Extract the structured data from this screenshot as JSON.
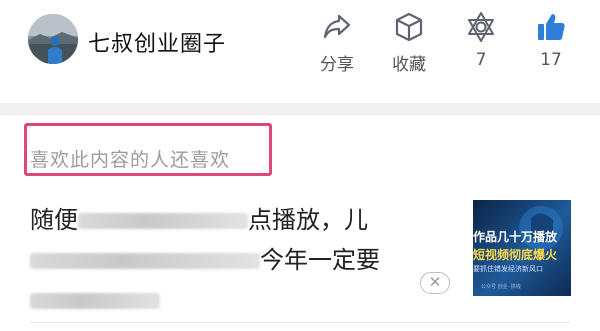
{
  "author": {
    "name": "七叔创业圈子"
  },
  "actions": {
    "share_label": "分享",
    "favorite_label": "收藏",
    "reward_count": "7",
    "like_count": "17"
  },
  "recommend": {
    "section_title": "喜欢此内容的人还喜欢",
    "article": {
      "title_visible_start": "随便",
      "title_visible_mid": "点播放，儿",
      "title_visible_end": "今年一定要",
      "close_glyph": "✕",
      "thumbnail": {
        "line1": "作品几十万播放",
        "line2": "短视频彻底爆火",
        "line3": "要抓住错发经济新风口",
        "line4": "公众号 创业 ·搞钱"
      }
    }
  },
  "colors": {
    "highlight_border": "#e0457b",
    "title_gray": "#9c9c9c",
    "icon_gray": "#5f6470"
  }
}
